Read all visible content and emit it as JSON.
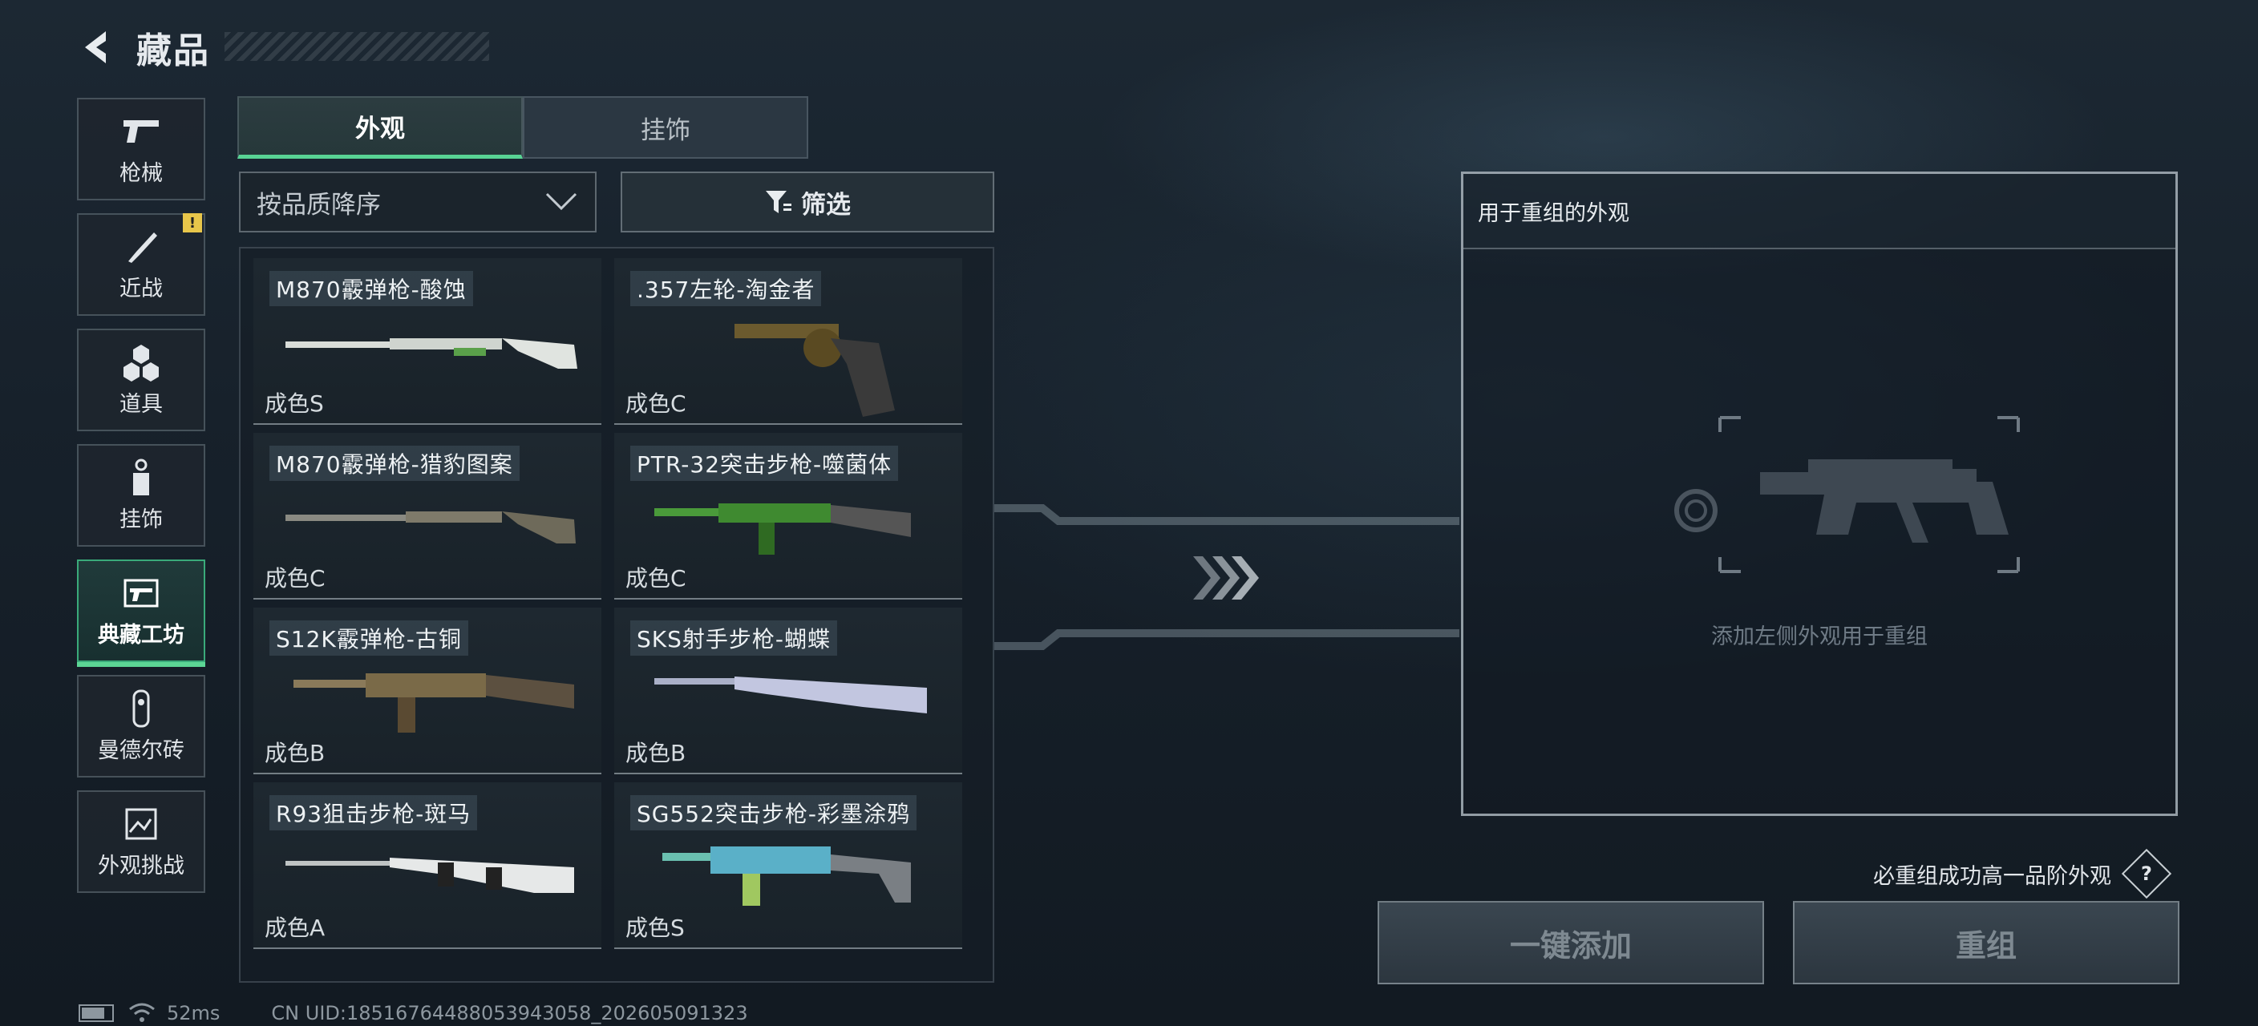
{
  "header": {
    "title": "藏品",
    "back_icon": "back-arrow-icon"
  },
  "sidebar": {
    "items": [
      {
        "label": "枪械",
        "icon": "pistol-icon",
        "active": false
      },
      {
        "label": "近战",
        "icon": "knife-icon",
        "active": false,
        "alert": "!"
      },
      {
        "label": "道具",
        "icon": "grenade-cluster-icon",
        "active": false
      },
      {
        "label": "挂饰",
        "icon": "charm-tag-icon",
        "active": false
      },
      {
        "label": "典藏工坊",
        "icon": "workshop-gun-icon",
        "active": true
      },
      {
        "label": "曼德尔砖",
        "icon": "mandel-brick-icon",
        "active": false
      },
      {
        "label": "外观挑战",
        "icon": "skin-challenge-icon",
        "active": false
      }
    ]
  },
  "tabs": [
    {
      "label": "外观",
      "active": true
    },
    {
      "label": "挂饰",
      "active": false
    }
  ],
  "sort": {
    "value": "按品质降序"
  },
  "filter": {
    "label": "筛选"
  },
  "items": [
    {
      "name": "M870霰弹枪-酸蚀",
      "grade": "成色S"
    },
    {
      "name": ".357左轮-淘金者",
      "grade": "成色C"
    },
    {
      "name": "M870霰弹枪-猎豹图案",
      "grade": "成色C"
    },
    {
      "name": "PTR-32突击步枪-噬菌体",
      "grade": "成色C"
    },
    {
      "name": "S12K霰弹枪-古铜",
      "grade": "成色B"
    },
    {
      "name": "SKS射手步枪-蝴蝶",
      "grade": "成色B"
    },
    {
      "name": "R93狙击步枪-斑马",
      "grade": "成色A"
    },
    {
      "name": "SG552突击步枪-彩墨涂鸦",
      "grade": "成色S"
    }
  ],
  "recombine": {
    "panel_title": "用于重组的外观",
    "hint": "添加左侧外观用于重组",
    "note": "必重组成功高一品阶外观",
    "help": "?",
    "add_button": "一键添加",
    "recombine_button": "重组"
  },
  "status": {
    "ping": "52ms",
    "uid": "CN UID:18516764488053943058_202605091323"
  },
  "colors": {
    "accent": "#58d394",
    "alert": "#e8c64a"
  }
}
